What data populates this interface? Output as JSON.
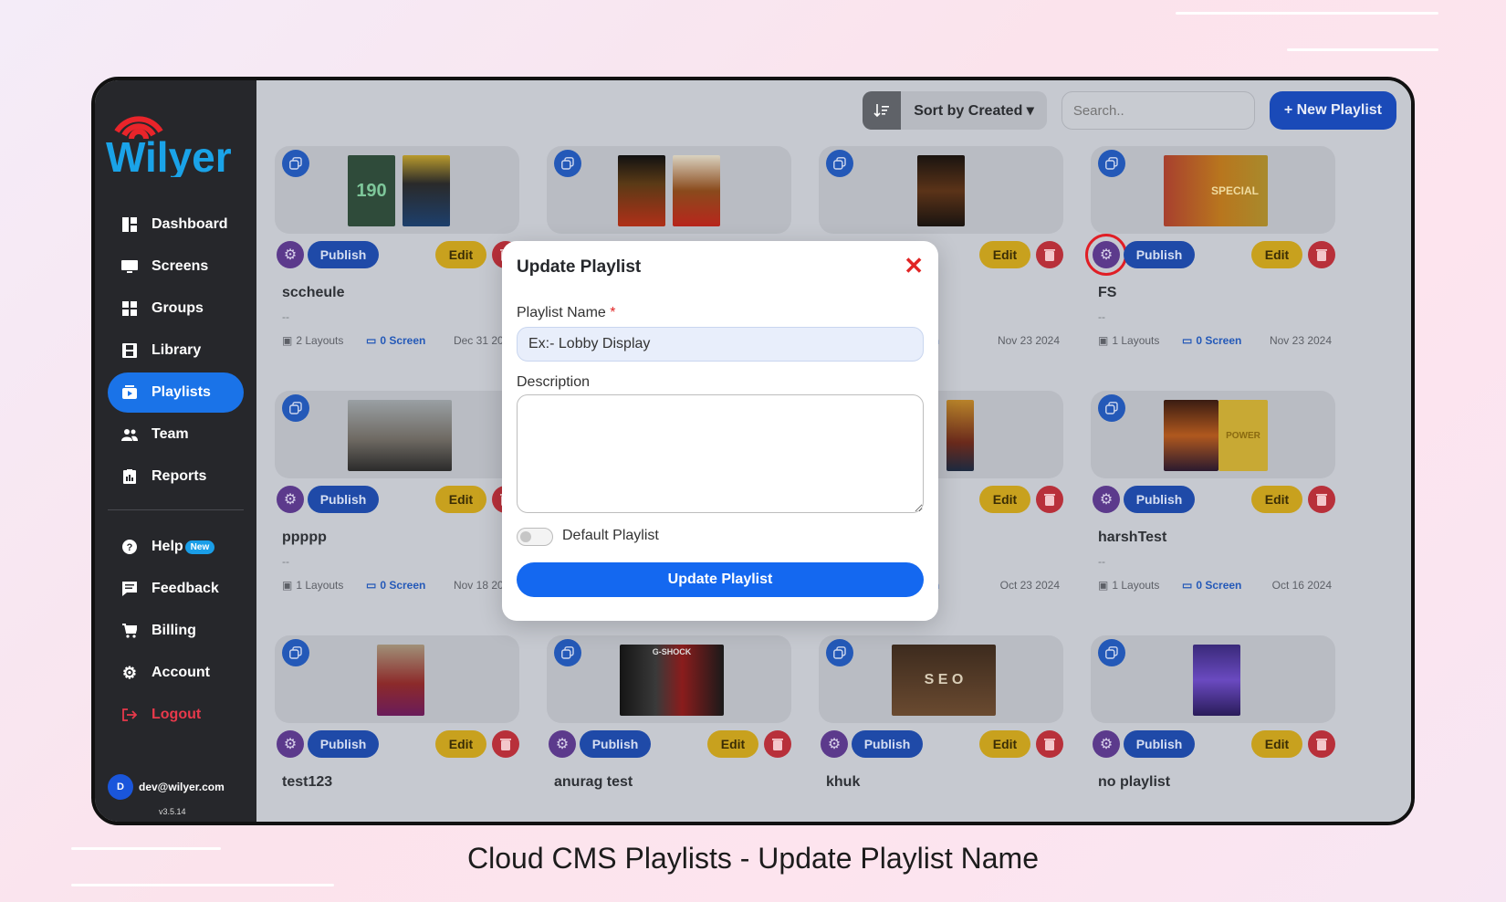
{
  "app": {
    "brand": "Wilyer"
  },
  "sidebar": {
    "items": [
      {
        "label": "Dashboard",
        "icon": "dashboard-icon"
      },
      {
        "label": "Screens",
        "icon": "monitor-icon"
      },
      {
        "label": "Groups",
        "icon": "grid-icon"
      },
      {
        "label": "Library",
        "icon": "film-icon"
      },
      {
        "label": "Playlists",
        "icon": "playlist-icon",
        "active": true
      },
      {
        "label": "Team",
        "icon": "team-icon"
      },
      {
        "label": "Reports",
        "icon": "reports-icon"
      }
    ],
    "secondary": [
      {
        "label": "Help",
        "icon": "help-icon",
        "badge": "New"
      },
      {
        "label": "Feedback",
        "icon": "feedback-icon"
      },
      {
        "label": "Billing",
        "icon": "cart-icon"
      },
      {
        "label": "Account",
        "icon": "gear-icon"
      },
      {
        "label": "Logout",
        "icon": "logout-icon"
      }
    ],
    "user": {
      "initial": "D",
      "email": "dev@wilyer.com"
    },
    "version": "v3.5.14"
  },
  "toolbar": {
    "sort_label": "Sort by Created",
    "search_placeholder": "Search..",
    "new_button": "+ New Playlist"
  },
  "card_labels": {
    "publish": "Publish",
    "edit": "Edit"
  },
  "cards": [
    {
      "name": "sccheule",
      "desc": "--",
      "layouts": "2 Layouts",
      "screens": "0 Screen",
      "date": "Dec 31 2024"
    },
    {
      "name": "",
      "desc": "",
      "layouts": "",
      "screens": "",
      "date": ""
    },
    {
      "name": "",
      "desc": "",
      "layouts": "",
      "screens": "creen",
      "date": "Nov 23 2024"
    },
    {
      "name": "FS",
      "desc": "--",
      "layouts": "1 Layouts",
      "screens": "0 Screen",
      "date": "Nov 23 2024"
    },
    {
      "name": "ppppp",
      "desc": "--",
      "layouts": "1 Layouts",
      "screens": "0 Screen",
      "date": "Nov 18 2024"
    },
    {
      "name": "",
      "desc": "",
      "layouts": "",
      "screens": "",
      "date": ""
    },
    {
      "name": "",
      "desc": "",
      "layouts": "",
      "screens": "creen",
      "date": "Oct 23 2024"
    },
    {
      "name": "harshTest",
      "desc": "--",
      "layouts": "1 Layouts",
      "screens": "0 Screen",
      "date": "Oct 16 2024"
    },
    {
      "name": "test123"
    },
    {
      "name": "anurag test"
    },
    {
      "name": "khuk"
    },
    {
      "name": "no playlist"
    }
  ],
  "thumb_texts": {
    "price": "190",
    "dshock": "G-SHOCK",
    "seo": "S E O",
    "special": "SPECIAL",
    "power": "POWER"
  },
  "modal": {
    "title": "Update Playlist",
    "name_label": "Playlist Name",
    "required_mark": "*",
    "name_value": "Ex:- Lobby Display",
    "description_label": "Description",
    "description_value": "",
    "default_label": "Default Playlist",
    "default_on": false,
    "submit_label": "Update Playlist"
  },
  "caption": "Cloud CMS Playlists - Update Playlist Name",
  "colors": {
    "accent": "#1468f0",
    "sidebar": "#26272b",
    "danger": "#e12525",
    "edit": "#f2c230"
  }
}
